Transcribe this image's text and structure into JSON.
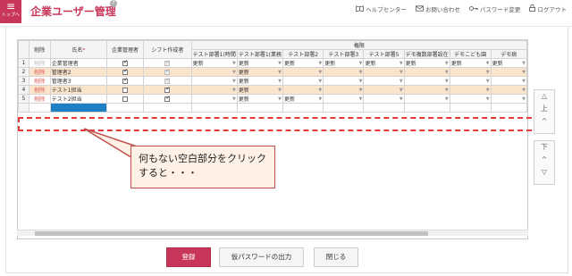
{
  "app": {
    "menu_icon": "≡",
    "menu_label": "トップへ",
    "title": "企業ユーザー管理",
    "help_badge": "?"
  },
  "header_links": [
    {
      "icon": "book-icon",
      "label": "ヘルプセンター"
    },
    {
      "icon": "mail-icon",
      "label": "お問い合わせ"
    },
    {
      "icon": "key-icon",
      "label": "パスワード変更"
    },
    {
      "icon": "lock-icon",
      "label": "ログアウト"
    }
  ],
  "grid": {
    "group_header": "権限",
    "columns": {
      "delete": "削除",
      "name": "氏名",
      "name_required": "*",
      "company_admin": "企業管理者",
      "shift_creator": "シフト作成者",
      "dept": [
        "テスト部署1(時間",
        "テスト部署1(業務",
        "テスト部署2",
        "テスト部署3",
        "テスト部署5",
        "デモ複数部署設在",
        "デモこども園",
        "デモ病"
      ]
    },
    "rows": [
      {
        "num": "1",
        "delete": "削除",
        "delete_active": false,
        "name": "企業管理者",
        "admin": true,
        "admin_disabled": false,
        "shift": true,
        "shift_disabled": true,
        "depts": [
          "更新",
          "更新",
          "更新",
          "更新",
          "更新",
          "更新",
          "更新",
          "更新"
        ],
        "orange": false
      },
      {
        "num": "2",
        "delete": "削除",
        "delete_active": true,
        "name": "管理者2",
        "admin": true,
        "admin_disabled": false,
        "shift": true,
        "shift_disabled": true,
        "depts": [
          "",
          "更新",
          "",
          "",
          "",
          "",
          "",
          ""
        ],
        "orange": true
      },
      {
        "num": "3",
        "delete": "削除",
        "delete_active": true,
        "name": "管理者3",
        "admin": true,
        "admin_disabled": false,
        "shift": true,
        "shift_disabled": true,
        "depts": [
          "",
          "更新",
          "",
          "",
          "",
          "",
          "",
          ""
        ],
        "orange": false
      },
      {
        "num": "4",
        "delete": "削除",
        "delete_active": true,
        "name": "テスト1担当",
        "admin": false,
        "admin_disabled": false,
        "shift": true,
        "shift_disabled": false,
        "depts": [
          "",
          "更新",
          "",
          "",
          "",
          "",
          "",
          ""
        ],
        "orange": true
      },
      {
        "num": "5",
        "delete": "削除",
        "delete_active": true,
        "name": "テスト2担当",
        "admin": false,
        "admin_disabled": false,
        "shift": true,
        "shift_disabled": false,
        "depts": [
          "",
          "更新",
          "更新",
          "",
          "",
          "",
          "",
          ""
        ],
        "orange": false
      }
    ]
  },
  "callout": {
    "line1": "何もない空白部分をクリック",
    "line2": "すると・・・"
  },
  "side_buttons": {
    "up_top_arrow": "△",
    "up_label": "上",
    "up_caret": "^",
    "down_label": "下",
    "down_caret": "^",
    "down_bottom_arrow": "▽"
  },
  "footer": {
    "register": "登録",
    "temp_password": "仮パスワードの出力",
    "close": "閉じる"
  }
}
